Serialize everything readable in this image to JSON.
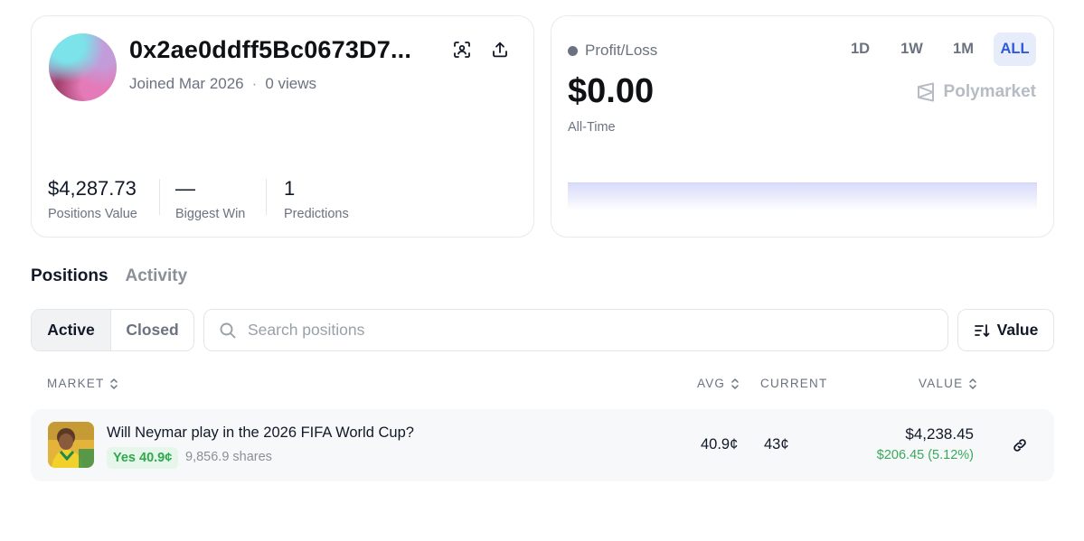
{
  "profile": {
    "address": "0x2ae0ddff5Bc0673D7...",
    "joined": "Joined Mar 2026",
    "separator": "·",
    "views": "0 views",
    "stats": [
      {
        "value": "$4,287.73",
        "label": "Positions Value"
      },
      {
        "value": "—",
        "label": "Biggest Win"
      },
      {
        "value": "1",
        "label": "Predictions"
      }
    ]
  },
  "pnl": {
    "label": "Profit/Loss",
    "value": "$0.00",
    "period": "All-Time",
    "ranges": [
      "1D",
      "1W",
      "1M",
      "ALL"
    ],
    "active_range": "ALL",
    "brand": "Polymarket",
    "accent_color": "#2d5bd8"
  },
  "tabs": {
    "positions": "Positions",
    "activity": "Activity",
    "active": "Positions"
  },
  "filters": {
    "active": "Active",
    "closed": "Closed",
    "search_placeholder": "Search positions",
    "search_value": "",
    "sort_label": "Value"
  },
  "table": {
    "headers": {
      "market": "MARKET",
      "avg": "AVG",
      "current": "CURRENT",
      "value": "VALUE"
    },
    "rows": [
      {
        "title": "Will Neymar play in the 2026 FIFA World Cup?",
        "outcome": "Yes 40.9¢",
        "shares": "9,856.9 shares",
        "avg": "40.9¢",
        "current": "43¢",
        "value": "$4,238.45",
        "pnl": "$206.45 (5.12%)"
      }
    ]
  },
  "colors": {
    "positive": "#3aa85a",
    "muted": "#6b7280"
  }
}
